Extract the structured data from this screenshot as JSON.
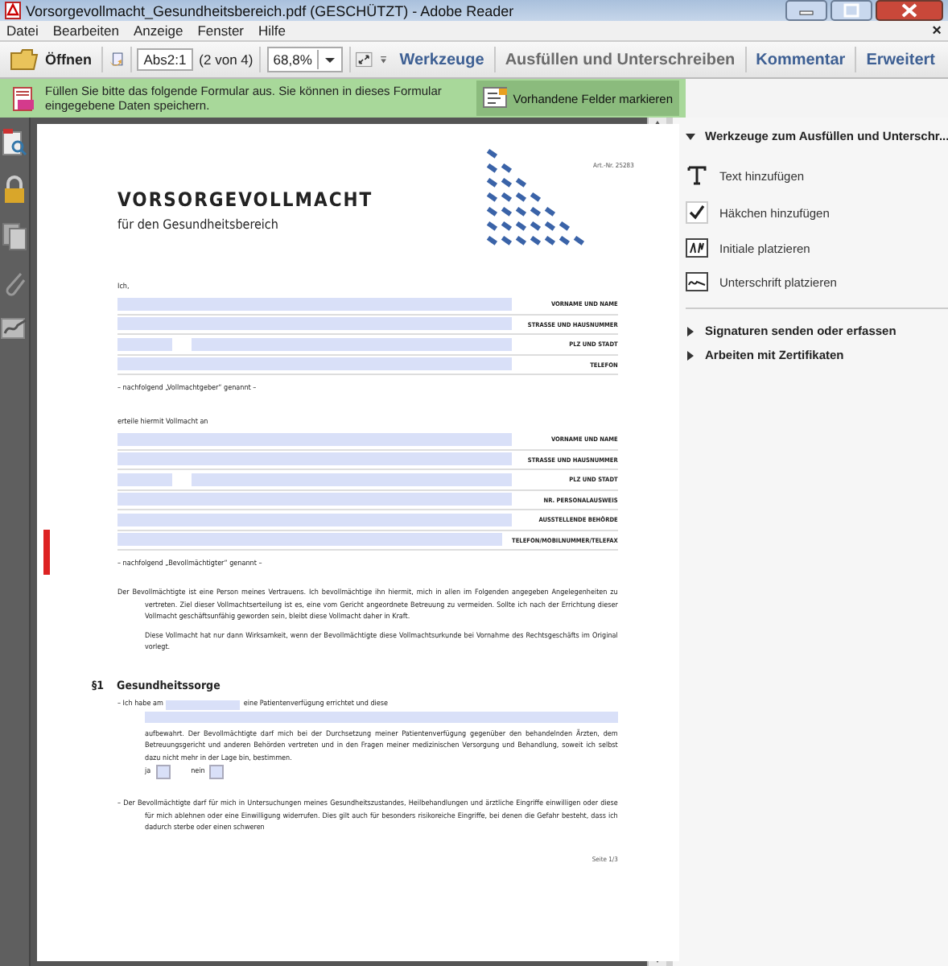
{
  "window": {
    "title": "Vorsorgevollmacht_Gesundheitsbereich.pdf (GESCHÜTZT) - Adobe Reader"
  },
  "menu": {
    "items": [
      "Datei",
      "Bearbeiten",
      "Anzeige",
      "Fenster",
      "Hilfe"
    ],
    "close": "×"
  },
  "toolbar": {
    "open": "Öffnen",
    "page_field": "Abs2:1",
    "page_count": "(2 von 4)",
    "zoom": "68,8%",
    "tabs": [
      {
        "label": "Werkzeuge",
        "selected": true
      },
      {
        "label": "Ausfüllen und Unterschreiben",
        "selected": false
      },
      {
        "label": "Kommentar",
        "selected": true
      },
      {
        "label": "Erweitert",
        "selected": true
      }
    ]
  },
  "info_bar": {
    "message": "Füllen Sie bitte das folgende Formular aus. Sie können in dieses Formular eingegebene Daten speichern.",
    "button": "Vorhandene Felder markieren"
  },
  "side_panel": {
    "sections": [
      {
        "title": "Werkzeuge zum Ausfüllen und Unterschr...",
        "expanded": true,
        "items": [
          {
            "kind": "text",
            "label": "Text hinzufügen"
          },
          {
            "kind": "check",
            "label": "Häkchen hinzufügen"
          },
          {
            "kind": "initials",
            "label": "Initiale platzieren"
          },
          {
            "kind": "signature",
            "label": "Unterschrift platzieren"
          }
        ]
      },
      {
        "title": "Signaturen senden oder erfassen",
        "expanded": false
      },
      {
        "title": "Arbeiten mit Zertifikaten",
        "expanded": false
      }
    ]
  },
  "document": {
    "art_nr": "Art.-Nr. 25283",
    "title": "VORSORGEVOLLMACHT",
    "subtitle": "für den Gesundheitsbereich",
    "intro": "Ich,",
    "fields_1": [
      {
        "kind": "full",
        "label": "VORNAME UND NAME"
      },
      {
        "kind": "full",
        "label": "STRASSE UND HAUSNUMMER"
      },
      {
        "kind": "split",
        "label": "PLZ UND STADT"
      },
      {
        "kind": "full",
        "label": "TELEFON"
      }
    ],
    "note_1": "– nachfolgend „Vollmachtgeber“ genannt –",
    "intro_2": "erteile hiermit Vollmacht an",
    "fields_2": [
      {
        "kind": "full",
        "label": "VORNAME UND NAME"
      },
      {
        "kind": "full",
        "label": "STRASSE UND HAUSNUMMER"
      },
      {
        "kind": "split",
        "label": "PLZ UND STADT"
      },
      {
        "kind": "full",
        "label": "NR. PERSONALAUSWEIS"
      },
      {
        "kind": "full",
        "label": "AUSSTELLENDE BEHÖRDE"
      },
      {
        "kind": "short",
        "label": "TELEFON/MOBILNUMMER/TELEFAX"
      }
    ],
    "note_2": "– nachfolgend „Bevollmächtigter“ genannt –",
    "paragraphs": [
      "Der Bevollmächtigte ist eine Person meines Vertrauens. Ich bevollmächtige ihn hiermit, mich in allen im Folgenden angegeben Angelegenheiten zu vertreten. Ziel dieser Vollmachtserteilung ist es, eine vom Gericht angeordnete Betreuung zu vermeiden. Sollte ich nach der Errichtung dieser Vollmacht geschäftsunfähig geworden sein, bleibt diese Vollmacht daher in Kraft.",
      "Diese Vollmacht hat nur dann Wirksamkeit, wenn der Bevollmächtigte diese Vollmachtsurkunde bei Vornahme des Rechtsgeschäfts im Original vorlegt."
    ],
    "section": {
      "number": "§1",
      "title": "Gesundheitssorge"
    },
    "item_1": {
      "before": "– Ich habe am",
      "after": "eine Patientenverfügung errichtet und diese",
      "text": "aufbewahrt. Der Bevollmächtigte darf mich bei der Durchsetzung meiner Patientenverfügung gegenüber den behandelnden Ärzten, dem Betreuungsgericht und anderen Behörden vertreten und in den Fragen meiner medizinischen Versorgung und Behandlung, soweit ich selbst dazu nicht mehr in der Lage bin, bestimmen.",
      "yes": "ja",
      "yes_checked": false,
      "no": "nein",
      "no_checked": false
    },
    "item_2": "– Der Bevollmächtigte darf für mich in Untersuchungen meines Gesundheitszustandes, Heilbehandlungen und ärztliche Eingriffe einwilligen oder diese für mich ablehnen oder eine Einwilligung widerrufen. Dies gilt auch für besonders risikoreiche Eingriffe, bei denen die Gefahr besteht, dass ich dadurch sterbe oder einen schweren",
    "page_number": "Seite 1/3"
  }
}
